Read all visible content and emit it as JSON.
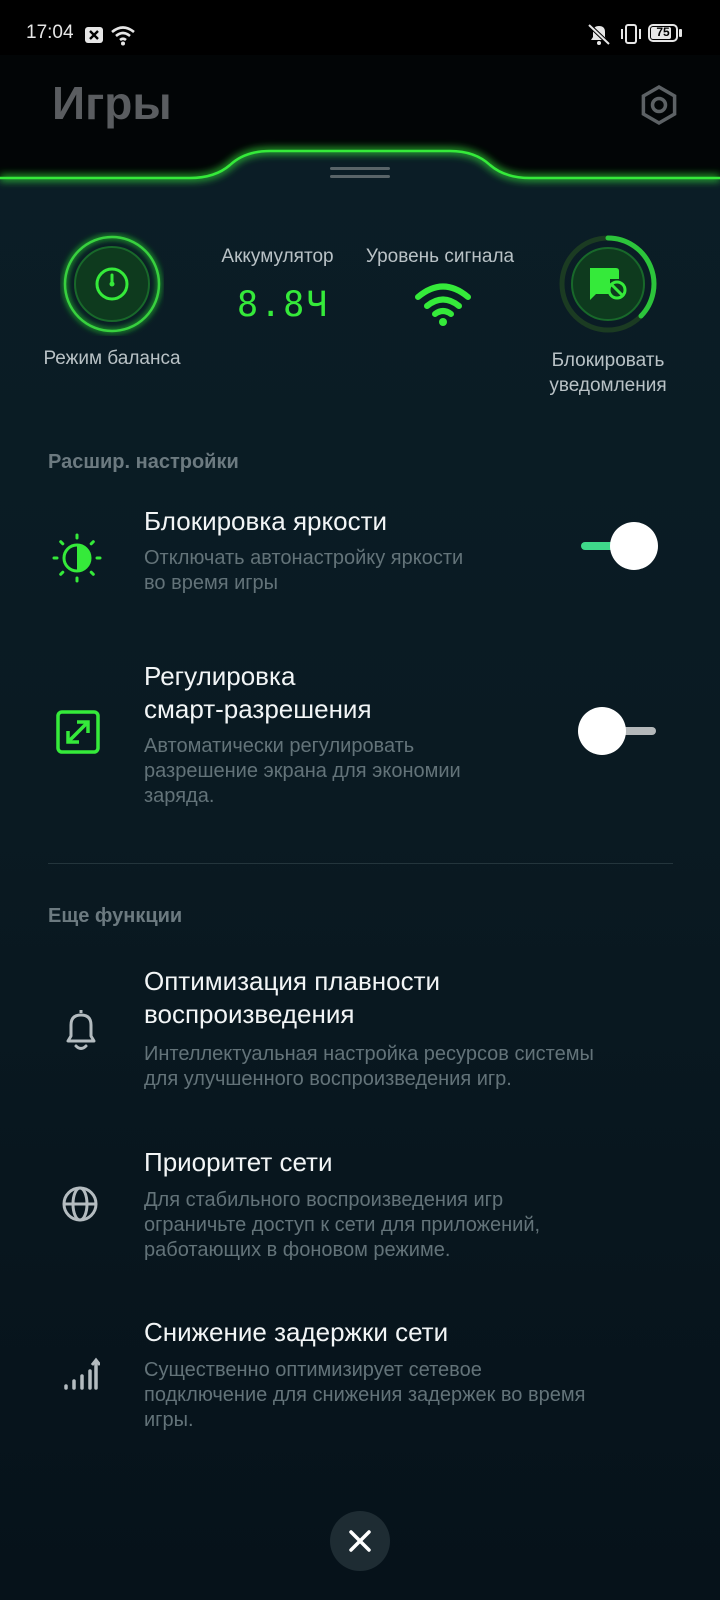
{
  "status_bar": {
    "time": "17:04",
    "battery": "75"
  },
  "header": {
    "title": "Игры"
  },
  "quick": {
    "balance_mode": "Режим баланса",
    "battery_label": "Аккумулятор",
    "battery_value": "8.8Ч",
    "signal_label": "Уровень сигнала",
    "block_notifications": [
      "Блокировать",
      "уведомления"
    ]
  },
  "advanced": {
    "section_title": "Расшир. настройки",
    "items": [
      {
        "title": [
          "Блокировка яркости"
        ],
        "desc": [
          "Отключать автонастройку яркости",
          "во время игры"
        ],
        "toggle": true
      },
      {
        "title": [
          "Регулировка",
          "смарт-разрешения"
        ],
        "desc": [
          "Автоматически регулировать",
          "разрешение экрана для экономии",
          "заряда."
        ],
        "toggle": false
      }
    ]
  },
  "more": {
    "section_title": "Еще функции",
    "items": [
      {
        "title": [
          "Оптимизация плавности",
          "воспроизведения"
        ],
        "desc": [
          "Интеллектуальная настройка ресурсов системы",
          "для улучшенного воспроизведения игр."
        ]
      },
      {
        "title": [
          "Приоритет сети"
        ],
        "desc": [
          "Для стабильного воспроизведения игр",
          "ограничьте доступ к сети для приложений,",
          "работающих в фоновом режиме."
        ]
      },
      {
        "title": [
          "Снижение задержки сети"
        ],
        "desc": [
          "Существенно оптимизирует сетевое",
          "подключение для снижения задержек во время",
          "игры."
        ]
      }
    ]
  },
  "colors": {
    "accent": "#35ea3a",
    "toggle_on": "#3fd98a"
  }
}
